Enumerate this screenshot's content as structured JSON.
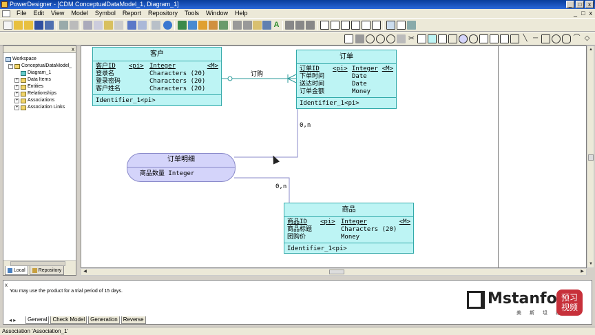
{
  "window": {
    "title": "PowerDesigner - [CDM ConceptualDataModel_1, Diagram_1]",
    "min_glyph": "_",
    "max_glyph": "□",
    "close_glyph": "x"
  },
  "menu": [
    "File",
    "Edit",
    "View",
    "Model",
    "Symbol",
    "Report",
    "Repository",
    "Tools",
    "Window",
    "Help"
  ],
  "menu_right": [
    "_",
    "□",
    "x"
  ],
  "browser": {
    "close_glyph": "x",
    "tree": [
      {
        "label": "Workspace",
        "icon": "workspace-icon"
      },
      {
        "label": "ConceptualDataModel_",
        "icon": "model-icon"
      },
      {
        "label": "Diagram_1",
        "icon": "diagram-icon"
      },
      {
        "label": "Data Items",
        "icon": "folder-icon"
      },
      {
        "label": "Entities",
        "icon": "folder-icon"
      },
      {
        "label": "Relationships",
        "icon": "folder-icon"
      },
      {
        "label": "Associations",
        "icon": "folder-icon"
      },
      {
        "label": "Association Links",
        "icon": "folder-icon"
      }
    ],
    "tabs": [
      "Local",
      "Repository"
    ]
  },
  "diagram": {
    "entities": [
      {
        "name": "客户",
        "attributes": [
          {
            "name": "客户ID",
            "tag": "<pi>",
            "type": "Integer",
            "flag": "<M>",
            "pk": true
          },
          {
            "name": "登录名",
            "tag": "",
            "type": "Characters (20)",
            "flag": "",
            "pk": false
          },
          {
            "name": "登录密码",
            "tag": "",
            "type": "Characters (20)",
            "flag": "",
            "pk": false
          },
          {
            "name": "客户姓名",
            "tag": "",
            "type": "Characters (20)",
            "flag": "",
            "pk": false
          }
        ],
        "identifier": "Identifier_1<pi>"
      },
      {
        "name": "订单",
        "attributes": [
          {
            "name": "订单ID",
            "tag": "<pi>",
            "type": "Integer",
            "flag": "<M>",
            "pk": true
          },
          {
            "name": "下单时间",
            "tag": "",
            "type": "Date",
            "flag": "",
            "pk": false
          },
          {
            "name": "送达时间",
            "tag": "",
            "type": "Date",
            "flag": "",
            "pk": false
          },
          {
            "name": "订单金额",
            "tag": "",
            "type": "Money",
            "flag": "",
            "pk": false
          }
        ],
        "identifier": "Identifier_1<pi>"
      },
      {
        "name": "商品",
        "attributes": [
          {
            "name": "商品ID",
            "tag": "<pi>",
            "type": "Integer",
            "flag": "<M>",
            "pk": true
          },
          {
            "name": "商品标题",
            "tag": "",
            "type": "Characters (20)",
            "flag": "",
            "pk": false
          },
          {
            "name": "团购价",
            "tag": "",
            "type": "Money",
            "flag": "",
            "pk": false
          }
        ],
        "identifier": "Identifier_1<pi>"
      }
    ],
    "association": {
      "name": "订单明细",
      "attribute": "商品数量 Integer"
    },
    "relationship_label": "订购",
    "cardinality_order": "0,n",
    "cardinality_product": "0,n"
  },
  "output": {
    "close_glyph": "x",
    "message": "You may use the product for a trial period of 15 days.",
    "tabs": [
      "General",
      "Check Model",
      "Generation",
      "Reverse"
    ],
    "nav": "◂ ▸"
  },
  "watermark": {
    "brand": "Mstanford",
    "sub": "美 斯 坦 福",
    "badge": "预习视频"
  },
  "status": "Association 'Association_1'",
  "colors": {
    "entity_fill": "#bdf4f4",
    "entity_border": "#33aaaa",
    "association_fill": "#d4d4fa",
    "title_bar": "#0a3e9b"
  }
}
